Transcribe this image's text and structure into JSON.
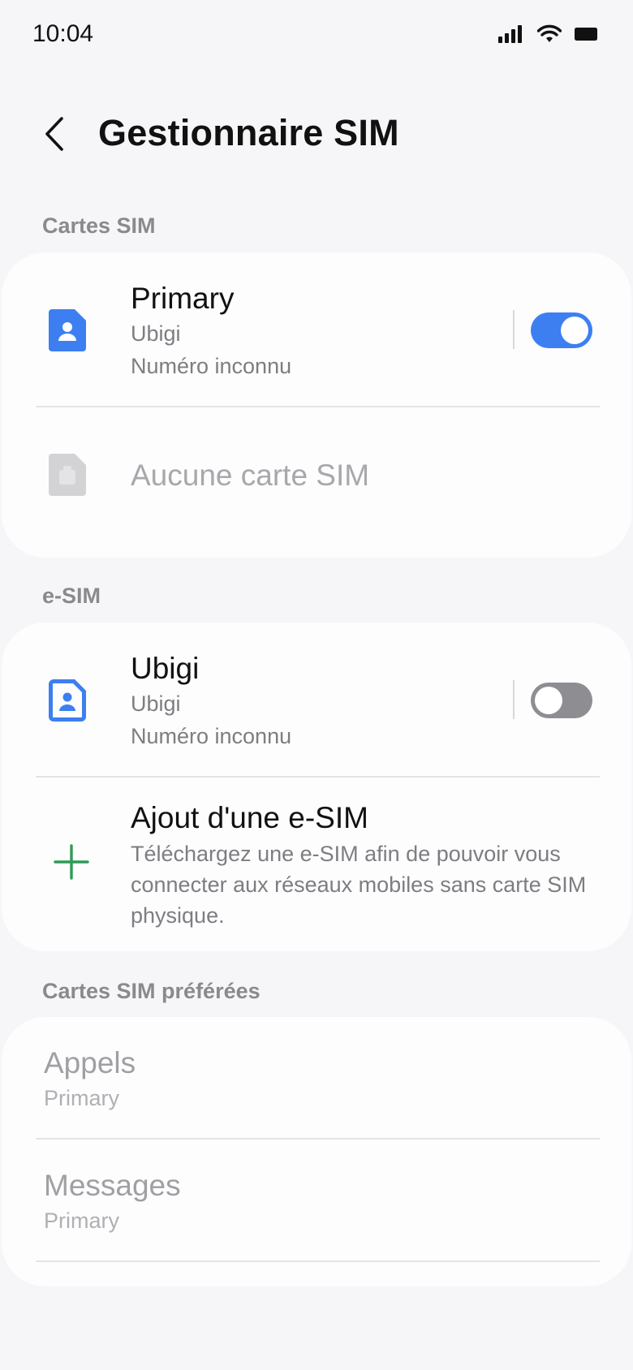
{
  "status_bar": {
    "time": "10:04",
    "icons": [
      "signal-icon",
      "wifi-icon",
      "battery-icon"
    ]
  },
  "header": {
    "title": "Gestionnaire SIM",
    "back_icon": "chevron-left-icon"
  },
  "sections": {
    "sim_cards_label": "Cartes SIM",
    "esim_label": "e-SIM",
    "preferred_label": "Cartes SIM préférées"
  },
  "sim_cards": {
    "primary": {
      "name": "Primary",
      "carrier": "Ubigi",
      "number": "Numéro inconnu",
      "enabled": true
    },
    "empty_slot": {
      "label": "Aucune carte SIM"
    }
  },
  "esim": {
    "profile": {
      "name": "Ubigi",
      "carrier": "Ubigi",
      "number": "Numéro inconnu",
      "enabled": false
    },
    "add": {
      "title": "Ajout d'une e-SIM",
      "description": "Téléchargez une e-SIM afin de pouvoir vous connecter aux réseaux mobiles sans carte SIM physique."
    }
  },
  "preferred": {
    "calls": {
      "title": "Appels",
      "value": "Primary"
    },
    "messages": {
      "title": "Messages",
      "value": "Primary"
    }
  },
  "colors": {
    "accent": "#3d7ff0",
    "add_icon": "#2e9b55",
    "background": "#f6f6f8",
    "card": "#fdfdfe"
  }
}
